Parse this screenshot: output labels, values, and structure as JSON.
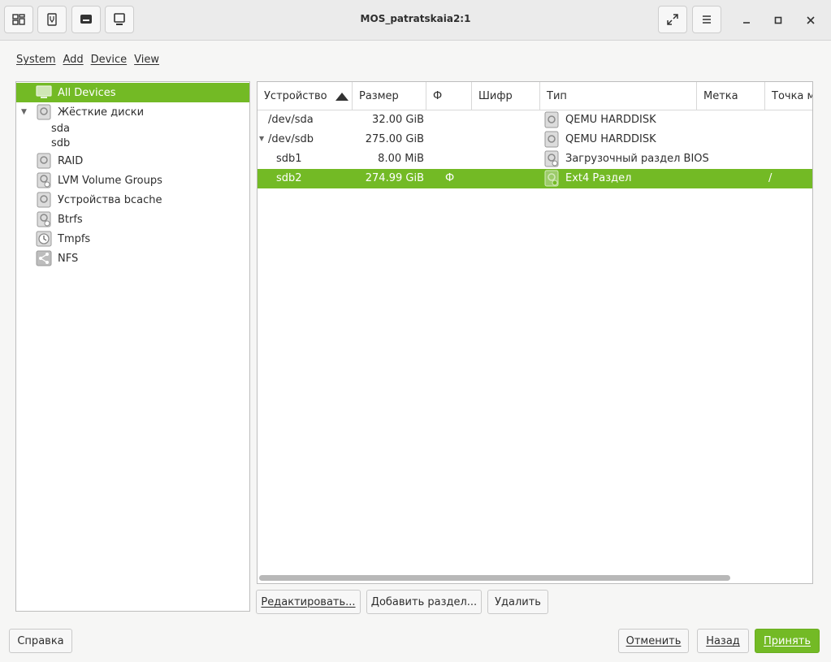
{
  "window": {
    "title": "MOS_patratskaia2:1"
  },
  "menu": {
    "system": "System",
    "add": "Add",
    "device": "Device",
    "view": "View"
  },
  "tree": {
    "all_devices": "All Devices",
    "hard_disks": "Жёсткие диски",
    "sda": "sda",
    "sdb": "sdb",
    "raid": "RAID",
    "lvm": "LVM Volume Groups",
    "bcache": "Устройства bcache",
    "btrfs": "Btrfs",
    "tmpfs": "Tmpfs",
    "nfs": "NFS"
  },
  "table": {
    "headers": {
      "device": "Устройство",
      "size": "Размер",
      "f": "Ф",
      "enc": "Шифр",
      "type": "Тип",
      "label": "Метка",
      "mount": "Точка мо"
    },
    "rows": [
      {
        "device": "/dev/sda",
        "size": "32.00 GiB",
        "f": "",
        "type": "QEMU HARDDISK",
        "mount": ""
      },
      {
        "device": "/dev/sdb",
        "size": "275.00 GiB",
        "f": "",
        "type": "QEMU HARDDISK",
        "mount": ""
      },
      {
        "device": "sdb1",
        "size": "8.00 MiB",
        "f": "",
        "type": "Загрузочный раздел BIOS",
        "mount": ""
      },
      {
        "device": "sdb2",
        "size": "274.99 GiB",
        "f": "Ф",
        "type": "Ext4 Раздел",
        "mount": "/"
      }
    ]
  },
  "actions": {
    "edit": "Редактировать...",
    "add_partition": "Добавить раздел...",
    "delete": "Удалить"
  },
  "footer": {
    "help": "Справка",
    "cancel": "Отменить",
    "back": "Назад",
    "accept": "Принять"
  },
  "colors": {
    "accent": "#73ba25"
  }
}
